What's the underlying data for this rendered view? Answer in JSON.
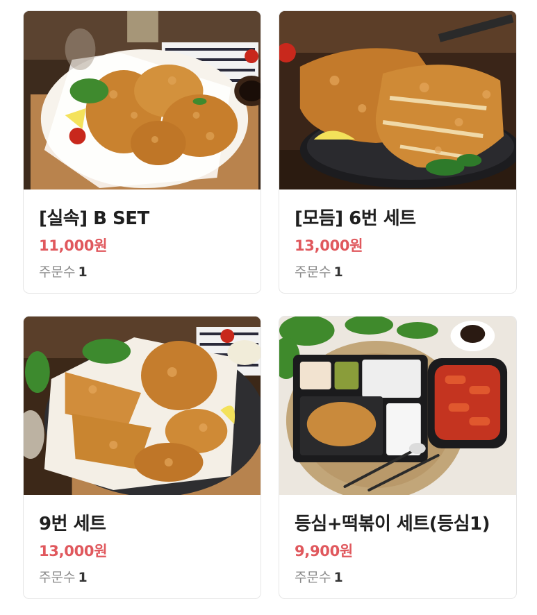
{
  "menu": {
    "items": [
      {
        "title": "[실속] B SET",
        "price": "11,000원",
        "orders_label": "주문수",
        "orders_count": "1"
      },
      {
        "title": "[모듬] 6번 세트",
        "price": "13,000원",
        "orders_label": "주문수",
        "orders_count": "1"
      },
      {
        "title": "9번 세트",
        "price": "13,000원",
        "orders_label": "주문수",
        "orders_count": "1"
      },
      {
        "title": "등심+떡볶이 세트(등심1)",
        "price": "9,900원",
        "orders_label": "주문수",
        "orders_count": "1"
      }
    ]
  },
  "colors": {
    "price": "#e0585d",
    "title": "#1f1f1f",
    "orders_label": "#8a8a8a",
    "card_border": "#e6e6e6"
  }
}
